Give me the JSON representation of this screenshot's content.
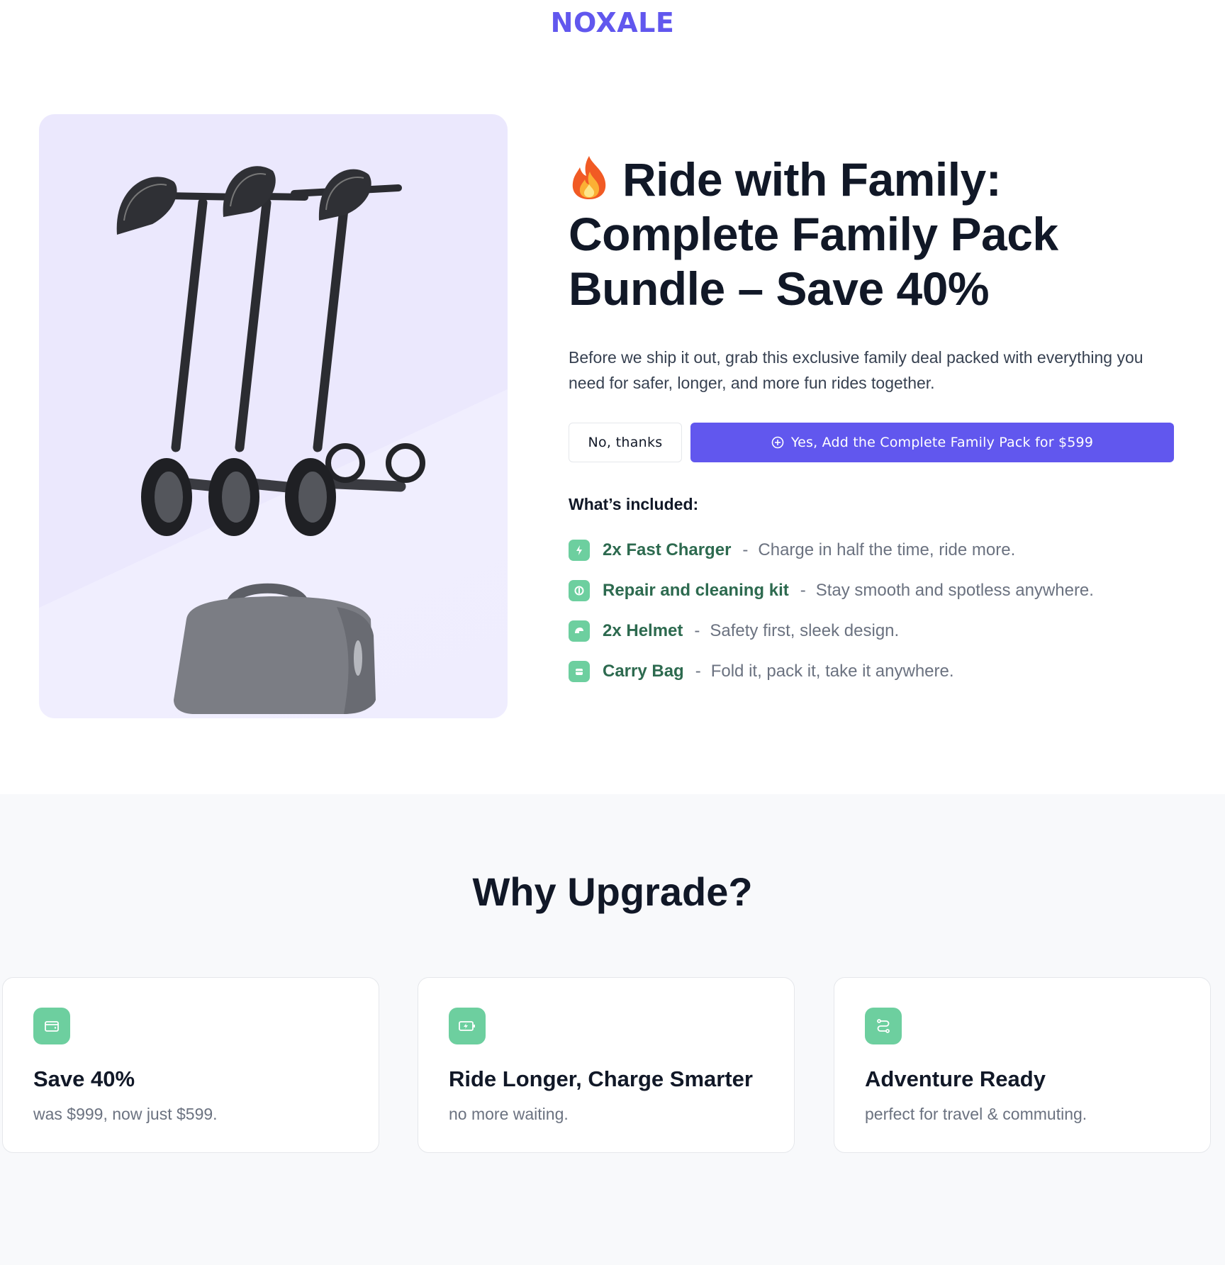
{
  "brand": {
    "logo": "NOXALE",
    "accent": "#6157ee",
    "green": "#6dcf9f"
  },
  "offer": {
    "title_line1": "Ride with Family:",
    "title_line2": "Complete Family Pack",
    "title_line3": "Bundle – Save 40%",
    "title_icon": "fire-icon",
    "description": "Before we ship it out, grab this exclusive family deal packed with everything you need for safer, longer, and more fun rides together.",
    "decline_label": "No, thanks",
    "accept_label": "Yes, Add the Complete Family Pack for $599",
    "image_alt": "three black kick scooters with helmets and a grey carry bag"
  },
  "included": {
    "heading": "What’s included:",
    "items": [
      {
        "name": "2x Fast Charger",
        "desc": "Charge in half the time, ride more.",
        "icon": "bolt-icon"
      },
      {
        "name": "Repair and cleaning kit",
        "desc": "Stay smooth and spotless anywhere.",
        "icon": "wrench-icon"
      },
      {
        "name": "2x Helmet",
        "desc": "Safety first, sleek design.",
        "icon": "helmet-icon"
      },
      {
        "name": "Carry Bag",
        "desc": "Fold it, pack it, take it anywhere.",
        "icon": "bag-icon"
      }
    ]
  },
  "why": {
    "heading": "Why Upgrade?",
    "cards": [
      {
        "title": "Save 40%",
        "text": "was $999, now just $599.",
        "icon": "wallet-icon"
      },
      {
        "title": "Ride Longer, Charge Smarter",
        "text": "no more waiting.",
        "icon": "battery-charging-icon"
      },
      {
        "title": "Adventure Ready",
        "text": "perfect for travel & commuting.",
        "icon": "route-icon"
      }
    ]
  }
}
